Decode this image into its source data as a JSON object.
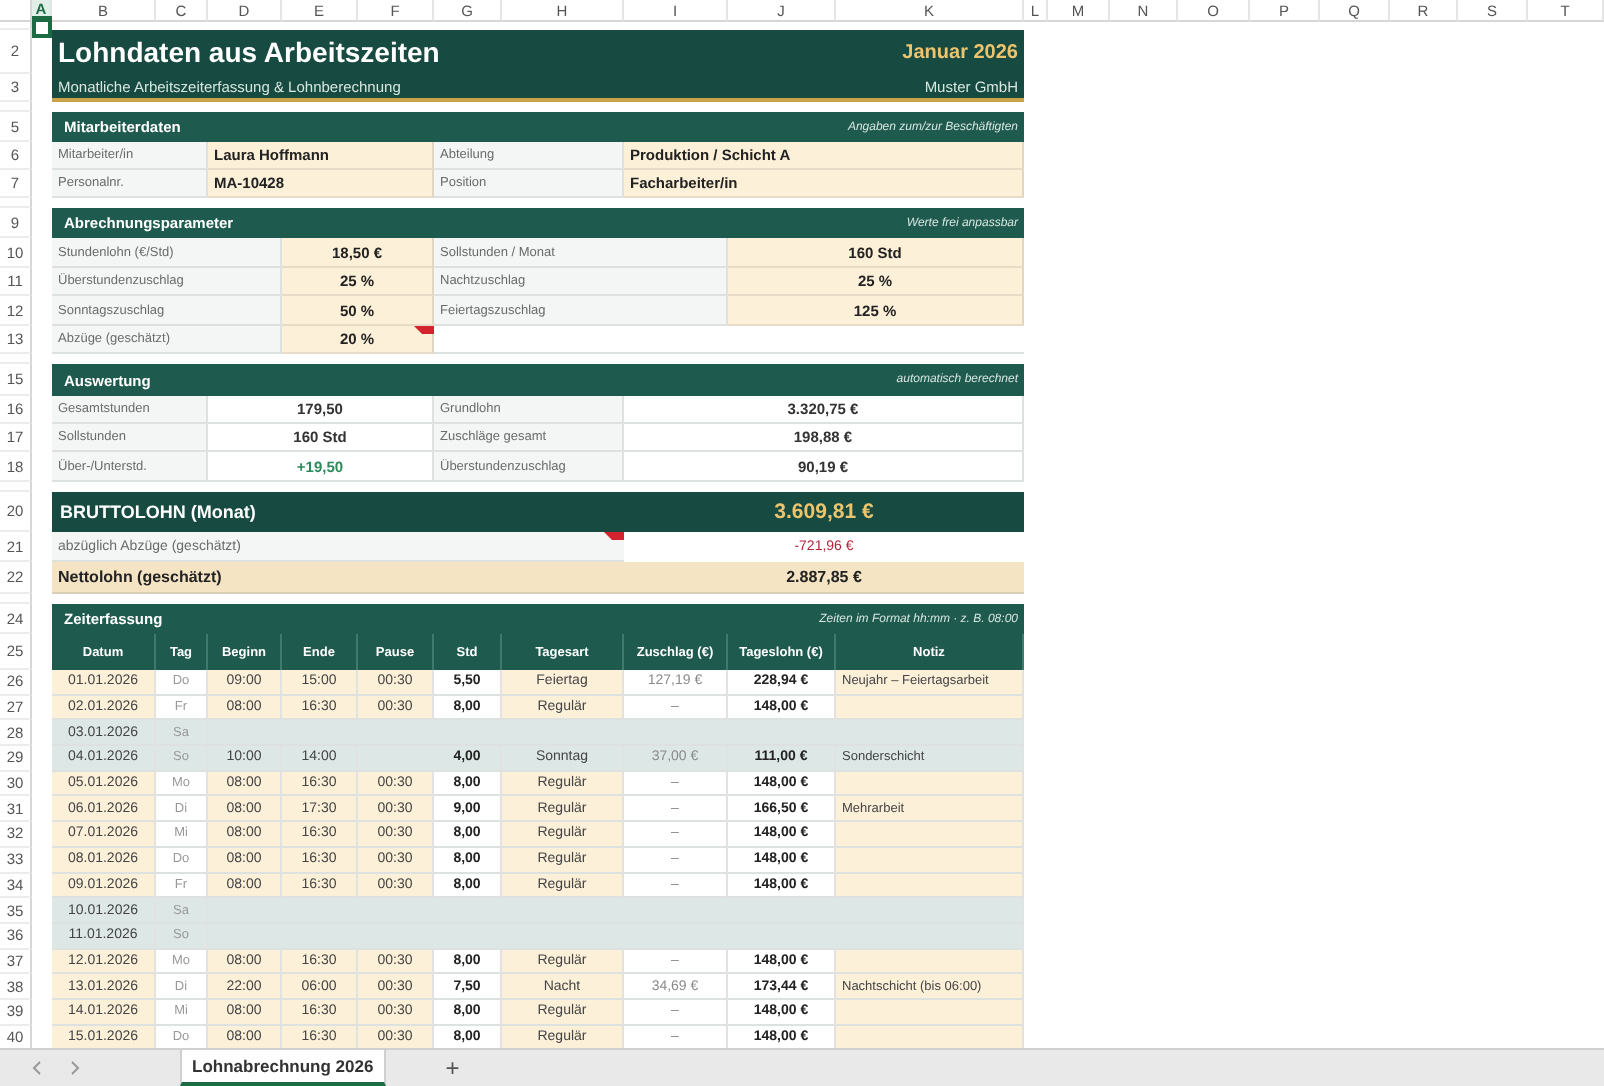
{
  "column_headers": [
    {
      "label": "A",
      "selected": true
    },
    {
      "label": "B",
      "selected": false
    },
    {
      "label": "C",
      "selected": false
    },
    {
      "label": "D",
      "selected": false
    },
    {
      "label": "E",
      "selected": false
    },
    {
      "label": "F",
      "selected": false
    },
    {
      "label": "G",
      "selected": false
    },
    {
      "label": "H",
      "selected": false
    },
    {
      "label": "I",
      "selected": false
    },
    {
      "label": "J",
      "selected": false
    },
    {
      "label": "K",
      "selected": false
    },
    {
      "label": "L",
      "selected": false
    },
    {
      "label": "M",
      "selected": false
    },
    {
      "label": "N",
      "selected": false
    },
    {
      "label": "O",
      "selected": false
    },
    {
      "label": "P",
      "selected": false
    },
    {
      "label": "Q",
      "selected": false
    },
    {
      "label": "R",
      "selected": false
    },
    {
      "label": "S",
      "selected": false
    },
    {
      "label": "T",
      "selected": false
    }
  ],
  "row_headers": [
    {
      "kind": "spacer"
    },
    {
      "kind": "row",
      "label": "2"
    },
    {
      "kind": "row",
      "label": "3"
    },
    {
      "kind": "spacer"
    },
    {
      "kind": "row",
      "label": "5"
    },
    {
      "kind": "row",
      "label": "6"
    },
    {
      "kind": "row",
      "label": "7"
    },
    {
      "kind": "spacer"
    },
    {
      "kind": "row",
      "label": "9"
    },
    {
      "kind": "row",
      "label": "10"
    },
    {
      "kind": "row",
      "label": "11"
    },
    {
      "kind": "row",
      "label": "12"
    },
    {
      "kind": "row",
      "label": "13"
    },
    {
      "kind": "spacer"
    },
    {
      "kind": "row",
      "label": "15"
    },
    {
      "kind": "row",
      "label": "16"
    },
    {
      "kind": "row",
      "label": "17"
    },
    {
      "kind": "row",
      "label": "18"
    },
    {
      "kind": "spacer"
    },
    {
      "kind": "row",
      "label": "20"
    },
    {
      "kind": "row",
      "label": "21"
    },
    {
      "kind": "row",
      "label": "22"
    },
    {
      "kind": "spacer"
    },
    {
      "kind": "row",
      "label": "24"
    },
    {
      "kind": "row",
      "label": "25"
    },
    {
      "kind": "row",
      "label": "26"
    },
    {
      "kind": "row",
      "label": "27"
    },
    {
      "kind": "row",
      "label": "28"
    },
    {
      "kind": "row",
      "label": "29"
    },
    {
      "kind": "row",
      "label": "30"
    },
    {
      "kind": "row",
      "label": "31"
    },
    {
      "kind": "row",
      "label": "32"
    },
    {
      "kind": "row",
      "label": "33"
    },
    {
      "kind": "row",
      "label": "34"
    },
    {
      "kind": "row",
      "label": "35"
    },
    {
      "kind": "row",
      "label": "36"
    },
    {
      "kind": "row",
      "label": "37"
    },
    {
      "kind": "row",
      "label": "38"
    },
    {
      "kind": "row",
      "label": "39"
    },
    {
      "kind": "row",
      "label": "40"
    }
  ],
  "header": {
    "title": "Lohndaten aus Arbeitszeiten",
    "month": "Januar 2026",
    "subtitle": "Monatliche Arbeitszeiterfassung & Lohnberechnung",
    "company": "Muster GmbH"
  },
  "employee": {
    "title": "Mitarbeiterdaten",
    "note": "Angaben zum/zur Beschäftigten",
    "fields": [
      {
        "label": "Mitarbeiter/in",
        "value": "Laura Hoffmann"
      },
      {
        "label": "Abteilung",
        "value": "Produktion / Schicht A"
      },
      {
        "label": "Personalnr.",
        "value": "MA-10428"
      },
      {
        "label": "Position",
        "value": "Facharbeiter/in"
      }
    ]
  },
  "parameters": {
    "title": "Abrechnungsparameter",
    "note": "Werte frei anpassbar",
    "fields": [
      {
        "label": "Stundenlohn (€/Std)",
        "value": "18,50 €",
        "comment": false
      },
      {
        "label": "Sollstunden / Monat",
        "value": "160 Std",
        "comment": false
      },
      {
        "label": "Überstundenzuschlag",
        "value": "25 %",
        "comment": false
      },
      {
        "label": "Nachtzuschlag",
        "value": "25 %",
        "comment": false
      },
      {
        "label": "Sonntagszuschlag",
        "value": "50 %",
        "comment": false
      },
      {
        "label": "Feiertagszuschlag",
        "value": "125 %",
        "comment": false
      },
      {
        "label": "Abzüge (geschätzt)",
        "value": "20 %",
        "comment": true
      }
    ]
  },
  "evaluation": {
    "title": "Auswertung",
    "note": "automatisch berechnet",
    "fields": [
      {
        "label": "Gesamtstunden",
        "value": "179,50",
        "kind": "plain"
      },
      {
        "label": "Grundlohn",
        "value": "3.320,75 €",
        "kind": "plain"
      },
      {
        "label": "Sollstunden",
        "value": "160 Std",
        "kind": "plain"
      },
      {
        "label": "Zuschläge gesamt",
        "value": "198,88 €",
        "kind": "plain"
      },
      {
        "label": "Über-/Unterstd.",
        "value": "+19,50",
        "kind": "positive"
      },
      {
        "label": "Überstundenzuschlag",
        "value": "90,19 €",
        "kind": "plain"
      }
    ]
  },
  "gross": {
    "label": "BRUTTOLOHN (Monat)",
    "value": "3.609,81 €"
  },
  "deductions": {
    "label": "abzüglich Abzüge (geschätzt)",
    "value": "-721,96 €",
    "comment": true
  },
  "net": {
    "label": "Nettolohn (geschätzt)",
    "value": "2.887,85 €"
  },
  "timesheet": {
    "title": "Zeiterfassung",
    "note": "Zeiten im Format hh:mm · z. B. 08:00",
    "columns": [
      "Datum",
      "Tag",
      "Beginn",
      "Ende",
      "Pause",
      "Std",
      "Tagesart",
      "Zuschlag (€)",
      "Tageslohn (€)",
      "Notiz"
    ],
    "rows": [
      {
        "kind": "workday",
        "date": "01.01.2026",
        "day": "Do",
        "start": "09:00",
        "end": "15:00",
        "pause": "00:30",
        "hours": "5,50",
        "type": "Feiertag",
        "surcharge": "127,19 €",
        "pay": "228,94 €",
        "note": "Neujahr – Feiertagsarbeit"
      },
      {
        "kind": "workday",
        "date": "02.01.2026",
        "day": "Fr",
        "start": "08:00",
        "end": "16:30",
        "pause": "00:30",
        "hours": "8,00",
        "type": "Regulär",
        "surcharge": "–",
        "pay": "148,00 €"
      },
      {
        "kind": "weekend",
        "date": "03.01.2026",
        "day": "Sa"
      },
      {
        "kind": "weekend",
        "date": "04.01.2026",
        "day": "So",
        "start": "10:00",
        "end": "14:00",
        "hours": "4,00",
        "type": "Sonntag",
        "surcharge": "37,00 €",
        "pay": "111,00 €",
        "note": "Sonderschicht"
      },
      {
        "kind": "workday",
        "date": "05.01.2026",
        "day": "Mo",
        "start": "08:00",
        "end": "16:30",
        "pause": "00:30",
        "hours": "8,00",
        "type": "Regulär",
        "surcharge": "–",
        "pay": "148,00 €"
      },
      {
        "kind": "workday",
        "date": "06.01.2026",
        "day": "Di",
        "start": "08:00",
        "end": "17:30",
        "pause": "00:30",
        "hours": "9,00",
        "type": "Regulär",
        "surcharge": "–",
        "pay": "166,50 €",
        "note": "Mehrarbeit"
      },
      {
        "kind": "workday",
        "date": "07.01.2026",
        "day": "Mi",
        "start": "08:00",
        "end": "16:30",
        "pause": "00:30",
        "hours": "8,00",
        "type": "Regulär",
        "surcharge": "–",
        "pay": "148,00 €"
      },
      {
        "kind": "workday",
        "date": "08.01.2026",
        "day": "Do",
        "start": "08:00",
        "end": "16:30",
        "pause": "00:30",
        "hours": "8,00",
        "type": "Regulär",
        "surcharge": "–",
        "pay": "148,00 €"
      },
      {
        "kind": "workday",
        "date": "09.01.2026",
        "day": "Fr",
        "start": "08:00",
        "end": "16:30",
        "pause": "00:30",
        "hours": "8,00",
        "type": "Regulär",
        "surcharge": "–",
        "pay": "148,00 €"
      },
      {
        "kind": "weekend",
        "date": "10.01.2026",
        "day": "Sa"
      },
      {
        "kind": "weekend",
        "date": "11.01.2026",
        "day": "So"
      },
      {
        "kind": "workday",
        "date": "12.01.2026",
        "day": "Mo",
        "start": "08:00",
        "end": "16:30",
        "pause": "00:30",
        "hours": "8,00",
        "type": "Regulär",
        "surcharge": "–",
        "pay": "148,00 €"
      },
      {
        "kind": "workday",
        "date": "13.01.2026",
        "day": "Di",
        "start": "22:00",
        "end": "06:00",
        "pause": "00:30",
        "hours": "7,50",
        "type": "Nacht",
        "surcharge": "34,69 €",
        "pay": "173,44 €",
        "note": "Nachtschicht (bis 06:00)"
      },
      {
        "kind": "workday",
        "date": "14.01.2026",
        "day": "Mi",
        "start": "08:00",
        "end": "16:30",
        "pause": "00:30",
        "hours": "8,00",
        "type": "Regulär",
        "surcharge": "–",
        "pay": "148,00 €"
      },
      {
        "kind": "workday",
        "date": "15.01.2026",
        "day": "Do",
        "start": "08:00",
        "end": "16:30",
        "pause": "00:30",
        "hours": "8,00",
        "type": "Regulär",
        "surcharge": "–",
        "pay": "148,00 €"
      }
    ]
  },
  "sheet_tabs": [
    {
      "label": "Lohnabrechnung 2026",
      "selected": true
    }
  ],
  "add_sheet": "+"
}
